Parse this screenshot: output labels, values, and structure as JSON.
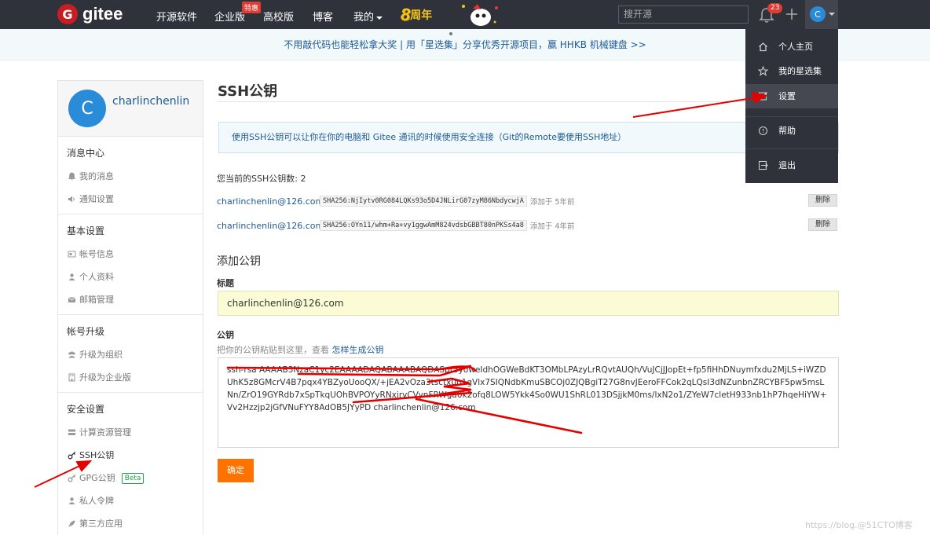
{
  "nav": {
    "logo_letter": "G",
    "logo_text": "gitee",
    "links": [
      "开源软件",
      "企业版",
      "高校版",
      "博客",
      "我的"
    ],
    "hot_badge": "特惠",
    "anniversary_num": "8",
    "anniversary_word": "周年",
    "search_placeholder": "搜开源",
    "notification_count": "23",
    "avatar_letter": "C"
  },
  "banner": {
    "text": "不用敲代码也能轻松拿大奖 | 用「星选集」分享优秀开源项目，赢 HHKB 机械键盘 >>"
  },
  "sidebar": {
    "avatar_letter": "C",
    "username": "charlinchenlin",
    "sections": [
      {
        "title": "消息中心",
        "items": [
          "我的消息",
          "通知设置"
        ]
      },
      {
        "title": "基本设置",
        "items": [
          "帐号信息",
          "个人资料",
          "邮箱管理"
        ]
      },
      {
        "title": "帐号升级",
        "items": [
          "升级为组织",
          "升级为企业版"
        ]
      },
      {
        "title": "安全设置",
        "items": [
          "计算资源管理",
          "SSH公钥",
          "GPG公钥",
          "私人令牌",
          "第三方应用"
        ]
      }
    ],
    "beta_label": "Beta"
  },
  "main": {
    "title": "SSH公钥",
    "info": "使用SSH公钥可以让你在你的电脑和 Gitee 通讯的时候使用安全连接（Git的Remote要使用SSH地址）",
    "key_count": "您当前的SSH公钥数: 2",
    "keys": [
      {
        "email": "charlinchenlin@126.com",
        "fingerprint": "SHA256:NjIytv0RG084LQKs93o5D4JNLirG07zyM86NbdycwjA",
        "added": "添加于 5年前",
        "delete": "删除"
      },
      {
        "email": "charlinchenlin@126.com",
        "fingerprint": "SHA256:OYn11/whm+Ra+vy1ggwAmM824vdsbGBBT80nPKSs4a8",
        "added": "添加于 4年前",
        "delete": "删除"
      }
    ],
    "add_title": "添加公钥",
    "title_label": "标题",
    "title_value": "charlinchenlin@126.com",
    "key_label": "公钥",
    "key_hint": "把你的公钥粘贴到这里，查看",
    "key_hint_link": "怎样生成公钥",
    "key_value": "ssh-rsa AAAAB3NzaC1yc2EAAAADAQABAAABAQDASpr5yoweIdhOGWeBdKT3OMbLPAzyLrRQvtAUQh/VuJCjJJopEt+fp5fiHhDNuymfxdu2MjLS+iWZDUhK5z8GMcrV4B7pqx4YBZyoUooQX/+jEA2vOza3tsctx0u1gVlx7SIQNdbKmuSBCOj0ZJQBgiT27G8nvJEeroFFCok2qLQsI3dNZunbnZRCYBF5pw5msLNn/ZrO19GYRdb7xSpTkqUOhBVPOYyRNxirvCVynFRWga0k2ofq8LOW5Ykk4So0WU1ShRL013DSjjkM0ms/lxN2o1/ZYeW7cletH933nb1hP7hqeHiYW+Vv2Hzzjp2jGfVNuFYY8AdOB5JYyPD charlinchenlin@126.com",
    "confirm": "确定"
  },
  "dropdown": {
    "items": [
      {
        "label": "个人主页",
        "icon": "home-icon"
      },
      {
        "label": "我的星选集",
        "icon": "star-icon"
      },
      {
        "label": "设置",
        "icon": "edit-icon"
      },
      {
        "label": "帮助",
        "icon": "help-icon"
      },
      {
        "label": "退出",
        "icon": "logout-icon"
      }
    ]
  },
  "watermark": "https://blog.@51CTO博客",
  "colors": {
    "nav_bg": "#2f323a",
    "brand_red": "#c71d23",
    "link_blue": "#1e5a96",
    "confirm_orange": "#fe7300",
    "annotation_red": "#e50000"
  }
}
